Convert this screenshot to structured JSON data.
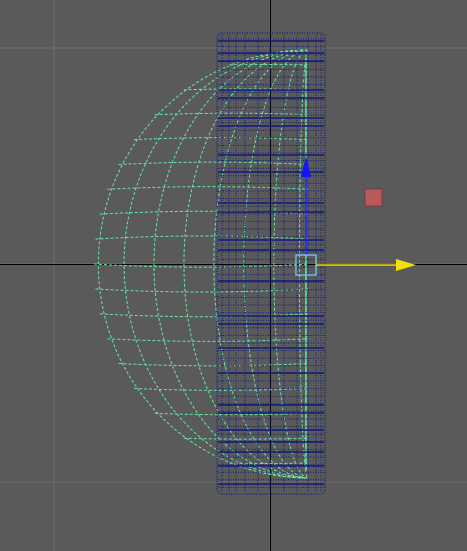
{
  "viewport": {
    "background": "#5a5a5a",
    "grid_color": "#6c6c6c",
    "axis_color": "#000000"
  },
  "objects": [
    {
      "name": "hemisphere-wireframe",
      "color": "#66e8a8",
      "style": "dashed",
      "selected": false
    },
    {
      "name": "cylinder-wireframe",
      "color": "#101a7a",
      "style": "dotted",
      "selected": true
    }
  ],
  "move_manipulator": {
    "x_axis_color": "#f2e100",
    "y_axis_color": "#1414ff",
    "center_handle_color": "#7fd2ff"
  },
  "marker": {
    "color": "#b85a5a"
  }
}
